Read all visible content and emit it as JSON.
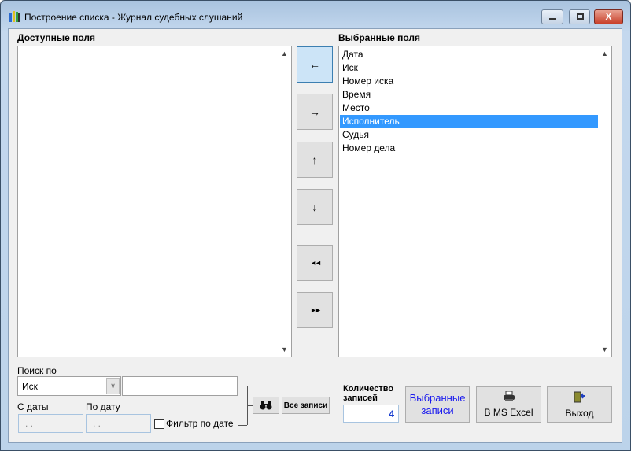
{
  "window": {
    "title": "Построение списка - Журнал судебных слушаний"
  },
  "available": {
    "label": "Доступные поля",
    "items": []
  },
  "selected": {
    "label": "Выбранные поля",
    "items": [
      "Дата",
      "Иск",
      "Номер иска",
      "Время",
      "Место",
      "Исполнитель",
      "Судья",
      "Номер дела"
    ],
    "selected_index": 5
  },
  "move_buttons": {
    "left": "←",
    "right": "→",
    "up": "↑",
    "down": "↓",
    "all_left": "◄◄",
    "all_right": "►►"
  },
  "search": {
    "label": "Поиск по",
    "field_value": "Иск",
    "text_value": "",
    "from_label": "С даты",
    "to_label": "По дату",
    "from_value": " . .",
    "to_value": " . .",
    "filter_label": "Фильтр по дате",
    "filter_checked": false,
    "all_records": "Все записи"
  },
  "count": {
    "label": "Количество записей",
    "value": "4"
  },
  "buttons": {
    "selected_records": "Выбранные записи",
    "excel": "В MS Excel",
    "exit": "Выход"
  }
}
